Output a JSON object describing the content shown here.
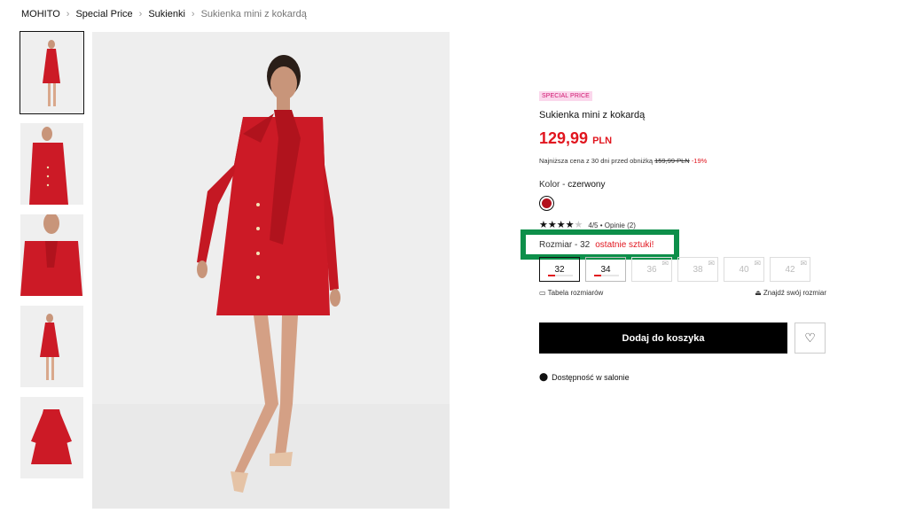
{
  "breadcrumb": [
    "MOHITO",
    "Special Price",
    "Sukienki",
    "Sukienka mini z kokardą"
  ],
  "product": {
    "badge": "SPECIAL PRICE",
    "title": "Sukienka mini z kokardą",
    "price": "129,99",
    "currency": "PLN",
    "lowest_text": "Najniższa cena z 30 dni przed obniżką",
    "old_price": "159,99 PLN",
    "discount": "-19%",
    "color_label": "Kolor - ",
    "color_value": "czerwony",
    "color_hex": "#b3101d"
  },
  "rating": {
    "stars_filled": 4,
    "stars_total": 5,
    "text": "4/5 • Opinie (2)"
  },
  "size_info": {
    "label": "Rozmiar - 32",
    "warning": "ostatnie sztuki!",
    "highlight_color": "#0d8f4a"
  },
  "sizes": [
    {
      "label": "32",
      "available": true,
      "selected": true,
      "stock": 0.2
    },
    {
      "label": "34",
      "available": true,
      "selected": false,
      "stock": 0.2
    },
    {
      "label": "36",
      "available": false
    },
    {
      "label": "38",
      "available": false
    },
    {
      "label": "40",
      "available": false
    },
    {
      "label": "42",
      "available": false
    }
  ],
  "links": {
    "size_chart": "Tabela rozmiarów",
    "find_size": "Znajdź swój rozmiar"
  },
  "actions": {
    "add_to_cart": "Dodaj do koszyka"
  },
  "store_availability": "Dostępność w salonie",
  "colors": {
    "accent_red": "#e1161f",
    "badge_bg": "#fbd7ec",
    "badge_text": "#d0166f"
  }
}
